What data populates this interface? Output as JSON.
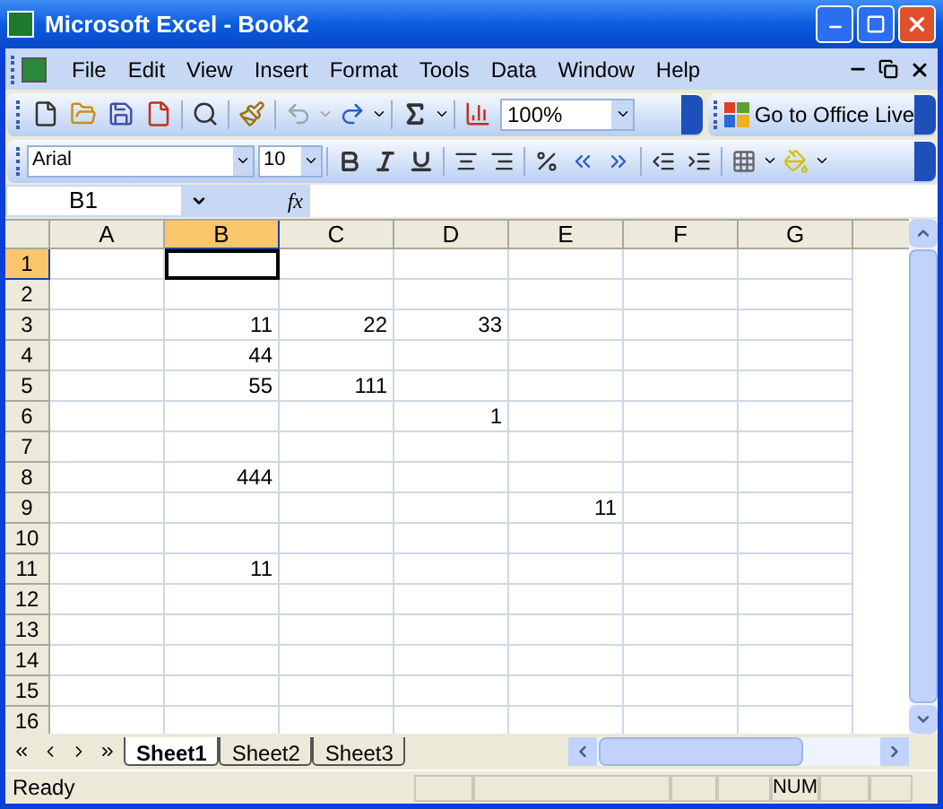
{
  "window": {
    "title": "Microsoft Excel - Book2"
  },
  "menu": [
    "File",
    "Edit",
    "View",
    "Insert",
    "Format",
    "Tools",
    "Data",
    "Window",
    "Help"
  ],
  "standard_toolbar": {
    "zoom": "100%",
    "office_live": "Go to Office Live"
  },
  "formatting_toolbar": {
    "font": "Arial",
    "size": "10"
  },
  "formula_bar": {
    "name_box": "B1",
    "fx": "fx"
  },
  "columns": [
    {
      "label": "A",
      "selected": false
    },
    {
      "label": "B",
      "selected": true
    },
    {
      "label": "C",
      "selected": false
    },
    {
      "label": "D",
      "selected": false
    },
    {
      "label": "E",
      "selected": false
    },
    {
      "label": "F",
      "selected": false
    },
    {
      "label": "G",
      "selected": false
    }
  ],
  "rows": [
    {
      "label": "1",
      "selected": true,
      "cells": [
        {},
        {
          "selected": true
        }
      ]
    },
    {
      "label": "2",
      "selected": false
    },
    {
      "label": "3",
      "selected": false,
      "cells": [
        {},
        {
          "text": "11"
        },
        {
          "text": "22"
        },
        {
          "text": "33"
        }
      ]
    },
    {
      "label": "4",
      "selected": false,
      "cells": [
        {},
        {
          "text": "44"
        }
      ]
    },
    {
      "label": "5",
      "selected": false,
      "cells": [
        {},
        {
          "text": "55"
        },
        {
          "text": "111"
        }
      ]
    },
    {
      "label": "6",
      "selected": false,
      "cells": [
        {},
        {},
        {},
        {
          "text": "1"
        }
      ]
    },
    {
      "label": "7",
      "selected": false
    },
    {
      "label": "8",
      "selected": false,
      "cells": [
        {},
        {
          "text": "444"
        }
      ]
    },
    {
      "label": "9",
      "selected": false,
      "cells": [
        {},
        {},
        {},
        {},
        {
          "text": "11"
        }
      ]
    },
    {
      "label": "10",
      "selected": false
    },
    {
      "label": "11",
      "selected": false,
      "cells": [
        {},
        {
          "text": "11"
        }
      ]
    },
    {
      "label": "12",
      "selected": false
    },
    {
      "label": "13",
      "selected": false
    },
    {
      "label": "14",
      "selected": false
    },
    {
      "label": "15",
      "selected": false
    },
    {
      "label": "16",
      "selected": false
    }
  ],
  "sheet_tabs": [
    {
      "label": "Sheet1",
      "selected": true
    },
    {
      "label": "Sheet2",
      "selected": false
    },
    {
      "label": "Sheet3",
      "selected": false
    }
  ],
  "status_bar": {
    "text": "Ready",
    "num": "NUM"
  }
}
